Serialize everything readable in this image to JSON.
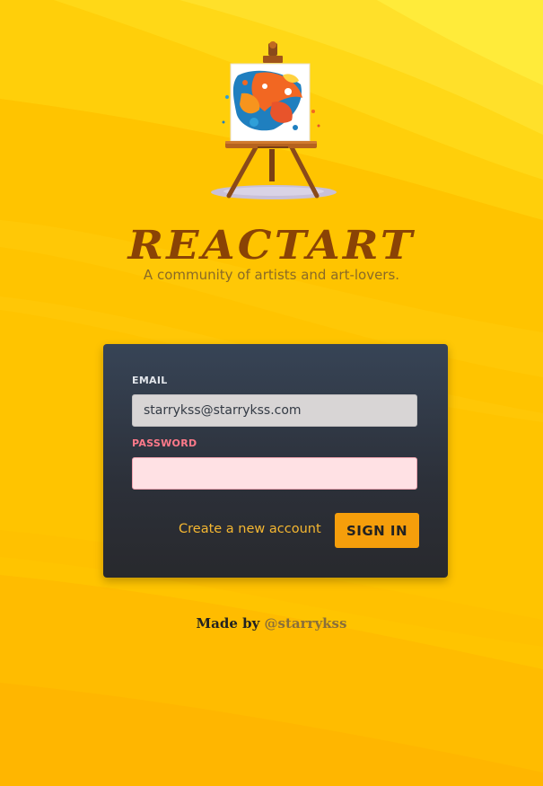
{
  "brand": {
    "title": "REACTART",
    "subtitle": "A community of artists and art-lovers.",
    "logo_icon": "easel-painting-icon"
  },
  "login_form": {
    "email_label": "EMAIL",
    "email_value": "starrykss@starrykss.com",
    "password_label": "PASSWORD",
    "password_value": "",
    "create_account_label": "Create a new account",
    "sign_in_label": "SIGN IN"
  },
  "footer": {
    "made_by_label": "Made by",
    "author": "@starrykss"
  },
  "colors": {
    "background": "#ffc400",
    "title": "#8a4305",
    "card_top": "#374456",
    "card_bottom": "#28292d",
    "accent": "#f59e0b",
    "link": "#f5b731",
    "password_label": "#ff7a8a",
    "password_field": "#ffe1e4"
  }
}
